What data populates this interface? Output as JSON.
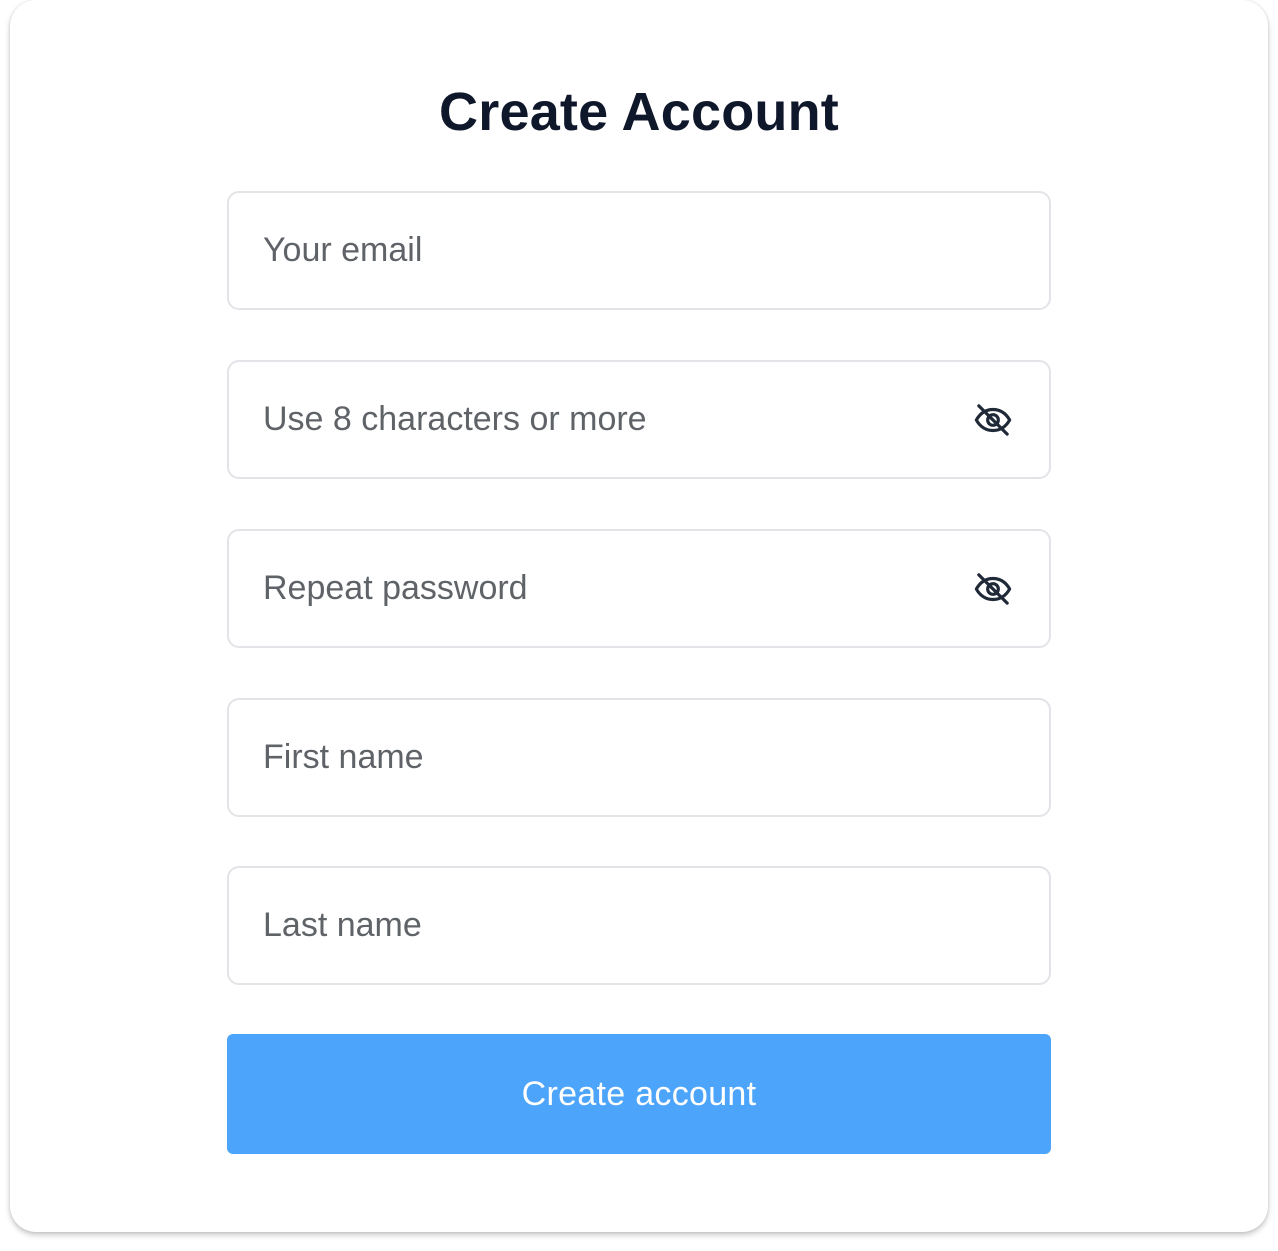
{
  "form": {
    "title": "Create Account",
    "fields": {
      "email": {
        "placeholder": "Your email",
        "value": ""
      },
      "password": {
        "placeholder": "Use 8 characters or more",
        "value": "",
        "icon": "eye-off-icon"
      },
      "repeat_password": {
        "placeholder": "Repeat password",
        "value": "",
        "icon": "eye-off-icon"
      },
      "first_name": {
        "placeholder": "First name",
        "value": ""
      },
      "last_name": {
        "placeholder": "Last name",
        "value": ""
      }
    },
    "submit_label": "Create account"
  },
  "colors": {
    "accent": "#4da5fb",
    "title": "#0f172a",
    "placeholder": "#5f6368",
    "border": "#e2e4e7"
  }
}
